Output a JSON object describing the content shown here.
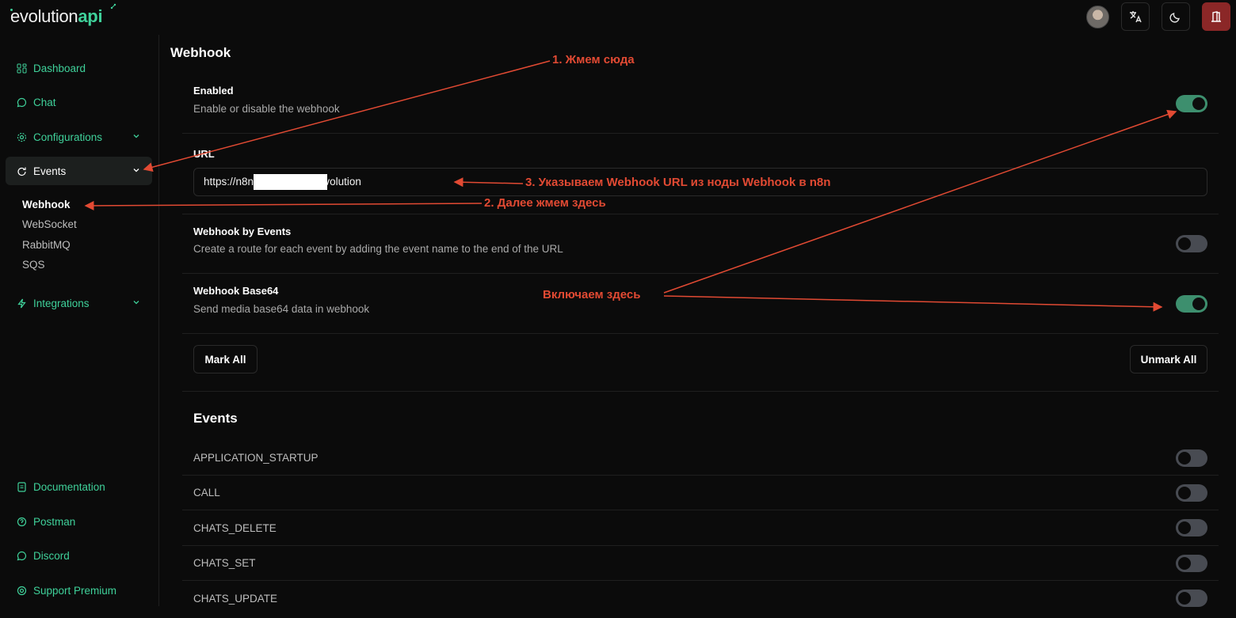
{
  "header": {
    "logo_main": "evolution",
    "logo_accent": "api"
  },
  "sidebar": {
    "items": [
      {
        "label": "Dashboard",
        "icon": "dashboard-icon"
      },
      {
        "label": "Chat",
        "icon": "chat-icon"
      },
      {
        "label": "Configurations",
        "icon": "gear-icon"
      },
      {
        "label": "Events",
        "icon": "events-icon"
      },
      {
        "label": "Integrations",
        "icon": "bolt-icon"
      }
    ],
    "event_subitems": [
      "Webhook",
      "WebSocket",
      "RabbitMQ",
      "SQS"
    ],
    "footer_items": [
      {
        "label": "Documentation",
        "icon": "document-icon"
      },
      {
        "label": "Postman",
        "icon": "postman-icon"
      },
      {
        "label": "Discord",
        "icon": "discord-icon"
      },
      {
        "label": "Support Premium",
        "icon": "support-icon"
      }
    ]
  },
  "main": {
    "title": "Webhook",
    "enabled": {
      "title": "Enabled",
      "description": "Enable or disable the webhook",
      "on": true
    },
    "url": {
      "label": "URL",
      "value": "https://n8n                    ebhook-test/ evolution"
    },
    "by_events": {
      "title": "Webhook by Events",
      "description": "Create a route for each event by adding the event name to the end of the URL",
      "on": false
    },
    "base64": {
      "title": "Webhook Base64",
      "description": "Send media base64 data in webhook",
      "on": true
    },
    "mark_all": "Mark All",
    "unmark_all": "Unmark All",
    "events_title": "Events",
    "events": [
      {
        "name": "APPLICATION_STARTUP",
        "on": false
      },
      {
        "name": "CALL",
        "on": false
      },
      {
        "name": "CHATS_DELETE",
        "on": false
      },
      {
        "name": "CHATS_SET",
        "on": false
      },
      {
        "name": "CHATS_UPDATE",
        "on": false
      }
    ]
  },
  "annotations": {
    "step1": "1. Жмем сюда",
    "step2": "2. Далее жмем здесь",
    "step3": "3. Указываем Webhook URL из ноды Webhook в n8n",
    "enable_here": "Включаем здесь"
  },
  "colors": {
    "accent": "#3fd19a",
    "toggle_on": "#3d8f6e",
    "toggle_off": "#484b52",
    "annotation": "#e24a33",
    "logout": "#8b2727"
  }
}
